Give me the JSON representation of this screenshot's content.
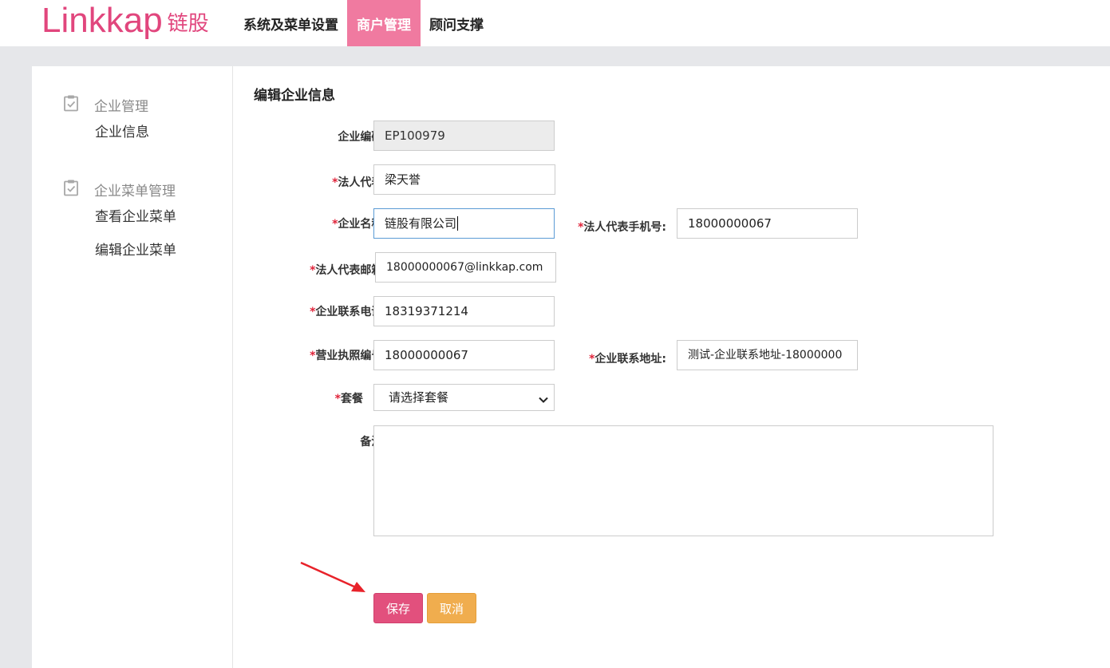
{
  "brand": {
    "logo_text": "Linkkap",
    "logo_cn": "链股",
    "accent": "#e1467d"
  },
  "nav": {
    "items": [
      {
        "label": "系统及菜单设置",
        "active": false
      },
      {
        "label": "商户管理",
        "active": true
      },
      {
        "label": "顾问支撑",
        "active": false
      }
    ]
  },
  "sidebar": {
    "groups": [
      {
        "title": "企业管理",
        "icon": "clipboard-check-icon",
        "links": [
          "企业信息"
        ]
      },
      {
        "title": "企业菜单管理",
        "icon": "clipboard-check-icon",
        "links": [
          "查看企业菜单",
          "编辑企业菜单"
        ]
      }
    ]
  },
  "form": {
    "title": "编辑企业信息",
    "required_mark": "*",
    "fields": {
      "code": {
        "label": "企业编码:",
        "value": "EP100979"
      },
      "legal_rep": {
        "label": "法人代表:",
        "value": "梁天誉"
      },
      "company_name": {
        "label": "企业名称:",
        "value": "链股有限公司"
      },
      "legal_phone": {
        "label": "法人代表手机号:",
        "value": "18000000067"
      },
      "legal_email": {
        "label": "法人代表邮箱:",
        "value": "18000000067@linkkap.com"
      },
      "company_phone": {
        "label": "企业联系电话:",
        "value": "18319371214"
      },
      "license_no": {
        "label": "营业执照编号:",
        "value": "18000000067"
      },
      "company_address": {
        "label": "企业联系地址:",
        "value": "测试-企业联系地址-18000000"
      },
      "package": {
        "label": "套餐",
        "value": "请选择套餐"
      },
      "remark": {
        "label": "备注:",
        "value": ""
      }
    },
    "buttons": {
      "save": "保存",
      "cancel": "取消"
    }
  }
}
